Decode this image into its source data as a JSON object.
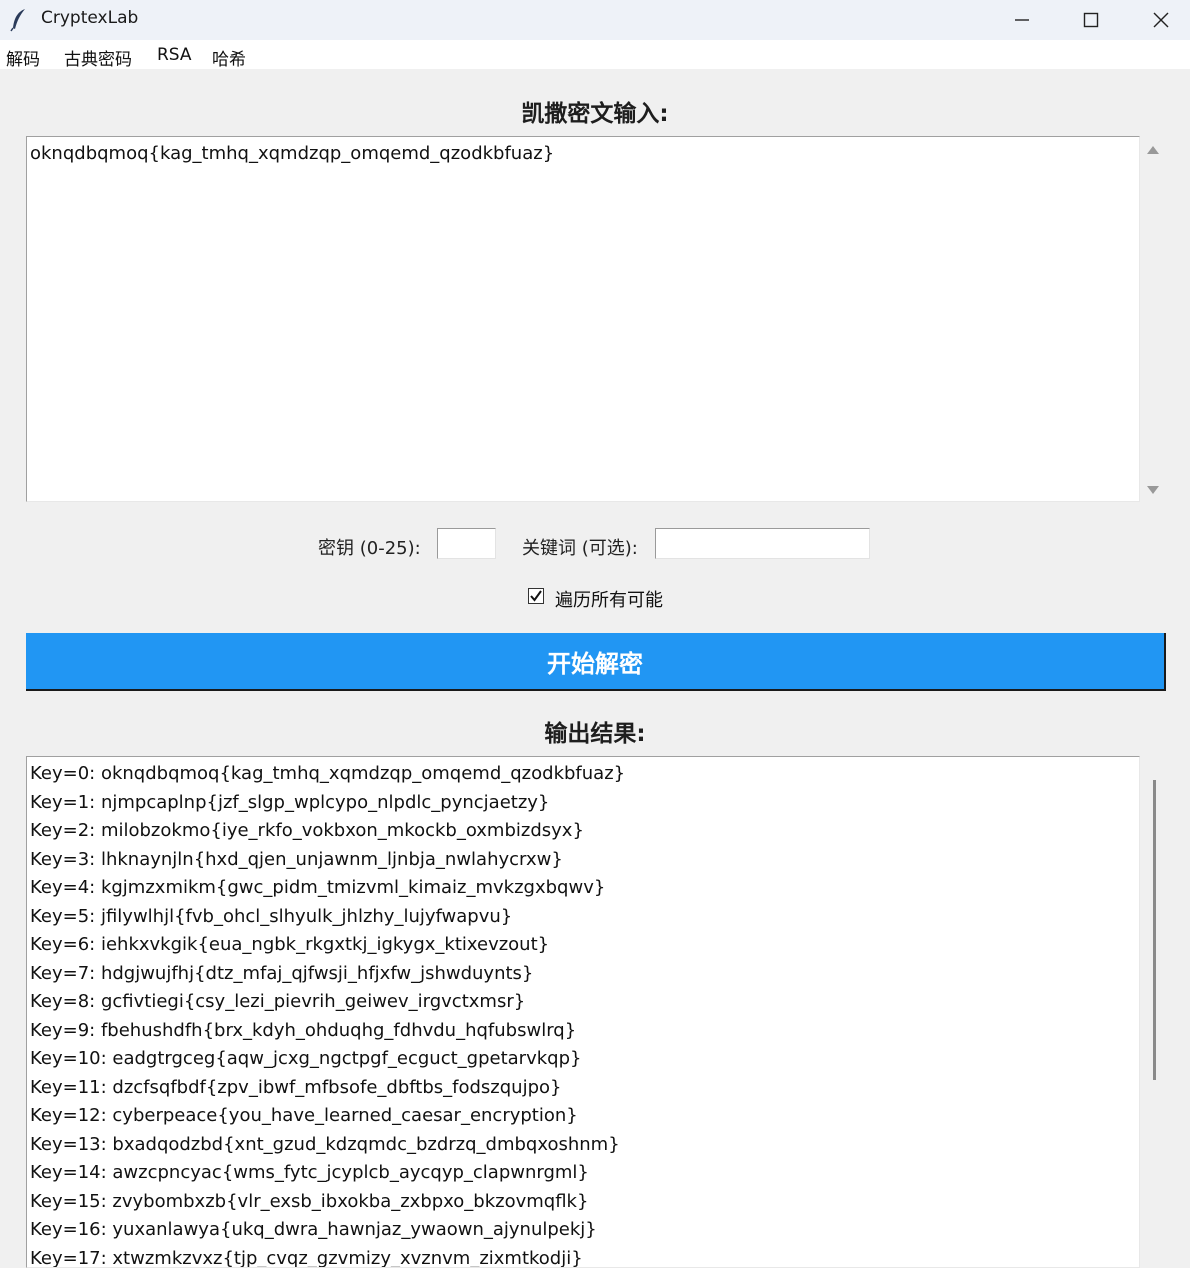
{
  "window": {
    "title": "CryptexLab",
    "icon": "feather-icon"
  },
  "menu": [
    "解码",
    "古典密码",
    "RSA",
    "哈希"
  ],
  "input_section": {
    "title": "凯撒密文输入:",
    "ciphertext": "oknqdbqmoq{kag_tmhq_xqmdzqp_omqemd_qzodkbfuaz}"
  },
  "controls": {
    "key_label": "密钥 (0-25):",
    "key_value": "",
    "keyword_label": "关键词 (可选):",
    "keyword_value": "",
    "brute_force_label": "遍历所有可能",
    "brute_force_checked": true
  },
  "decrypt_button": {
    "label": "开始解密",
    "color": "#2196f3"
  },
  "output_section": {
    "title": "输出结果:",
    "lines": [
      "Key=0: oknqdbqmoq{kag_tmhq_xqmdzqp_omqemd_qzodkbfuaz}",
      "Key=1: njmpcaplnp{jzf_slgp_wplcypo_nlpdlc_pyncjaetzy}",
      "Key=2: milobzokmo{iye_rkfo_vokbxon_mkockb_oxmbizdsyx}",
      "Key=3: lhknaynjln{hxd_qjen_unjawnm_ljnbja_nwlahycrxw}",
      "Key=4: kgjmzxmikm{gwc_pidm_tmizvml_kimaiz_mvkzgxbqwv}",
      "Key=5: jfilywlhjl{fvb_ohcl_slhyulk_jhlzhy_lujyfwapvu}",
      "Key=6: iehkxvkgik{eua_ngbk_rkgxtkj_igkygx_ktixevzout}",
      "Key=7: hdgjwujfhj{dtz_mfaj_qjfwsji_hfjxfw_jshwduynts}",
      "Key=8: gcfivtiegi{csy_lezi_pievrih_geiwev_irgvctxmsr}",
      "Key=9: fbehushdfh{brx_kdyh_ohduqhg_fdhvdu_hqfubswlrq}",
      "Key=10: eadgtrgceg{aqw_jcxg_ngctpgf_ecguct_gpetarvkqp}",
      "Key=11: dzcfsqfbdf{zpv_ibwf_mfbsofe_dbftbs_fodszqujpo}",
      "Key=12: cyberpeace{you_have_learned_caesar_encryption}",
      "Key=13: bxadqodzbd{xnt_gzud_kdzqmdc_bzdrzq_dmbqxoshnm}",
      "Key=14: awzcpncyac{wms_fytc_jcyplcb_aycqyp_clapwnrgml}",
      "Key=15: zvybombxzb{vlr_exsb_ibxokba_zxbpxo_bkzovmqflk}",
      "Key=16: yuxanlawya{ukq_dwra_hawnjaz_ywaown_ajynulpekj}",
      "Key=17: xtwzmkzvxz{tjp_cvqz_gzvmizy_xvznvm_zixmtkodji}"
    ]
  }
}
